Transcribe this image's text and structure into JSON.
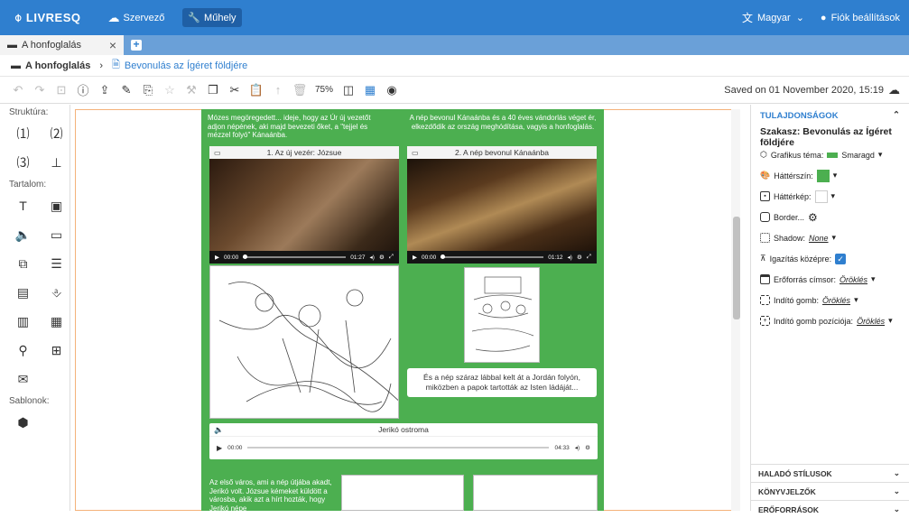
{
  "topbar": {
    "logo": "LIVRESQ",
    "organizer": "Szervező",
    "workshop": "Műhely",
    "language": "Magyar",
    "account": "Fiók beállítások"
  },
  "tabs": [
    {
      "label": "A honfoglalás"
    }
  ],
  "breadcrumb": {
    "root": "A honfoglalás",
    "current": "Bevonulás az Ígéret földjére"
  },
  "toolbar": {
    "zoom": "75%",
    "saved": "Saved on 01 November 2020, 15:19"
  },
  "left_sidebar": {
    "structure": "Struktúra:",
    "content": "Tartalom:",
    "templates": "Sablonok:"
  },
  "canvas": {
    "text1": "Mózes megöregedett... ideje, hogy az Úr új vezetőt adjon népének, aki majd bevezeti őket, a \"tejjel és mézzel folyó\" Kánaánba.",
    "text2": "A nép bevonul Kánaánba és a 40 éves vándorlás véget ér, elkezdődik az ország meghódítása, vagyis a honfoglalás.",
    "video1": {
      "title": "1. Az új vezér: Józsue",
      "time": "00:00",
      "duration": "01:27"
    },
    "video2": {
      "title": "2. A nép bevonul Kánaánba",
      "time": "00:00",
      "duration": "01:12"
    },
    "caption": "És a nép száraz lábbal kelt át a Jordán folyón, miközben a papok tartották az Isten ládáját...",
    "audio": {
      "title": "Jerikó ostroma",
      "time": "00:00",
      "duration": "04:33"
    },
    "text3": "Az első város, ami a nép útjába akadt, Jerikó volt. Józsue kémeket küldött a városba, akik azt a hírt hozták, hogy Jerikó népe"
  },
  "right_panel": {
    "title": "TULAJDONSÁGOK",
    "section": "Szakasz: Bevonulás az Ígéret földjére",
    "theme_label": "Grafikus téma:",
    "theme_value": "Smaragd",
    "bg_color_label": "Háttérszín:",
    "bg_image_label": "Háttérkép:",
    "border_label": "Border...",
    "shadow_label": "Shadow:",
    "shadow_value": "None",
    "align_label": "Igazítás középre:",
    "resource_title_label": "Erőforrás címsor:",
    "resource_title_value": "Öröklés",
    "start_button_label": "Indító gomb:",
    "start_button_value": "Öröklés",
    "start_pos_label": "Indító gomb pozíciója:",
    "start_pos_value": "Öröklés",
    "accordions": [
      "HALADÓ STÍLUSOK",
      "KÖNYVJELZŐK",
      "ERŐFORRÁSOK"
    ]
  },
  "colors": {
    "topbar": "#2f7fcf",
    "section_bg": "#4caf50",
    "swatch": "#4caf50"
  }
}
